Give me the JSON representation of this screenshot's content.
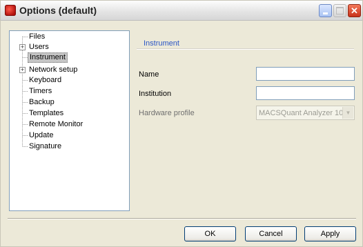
{
  "window": {
    "title": "Options (default)"
  },
  "tree": {
    "items": [
      {
        "label": "Files",
        "expandable": false,
        "selected": false
      },
      {
        "label": "Users",
        "expandable": true,
        "selected": false
      },
      {
        "label": "Instrument",
        "expandable": false,
        "selected": true
      },
      {
        "label": "Network setup",
        "expandable": true,
        "selected": false
      },
      {
        "label": "Keyboard",
        "expandable": false,
        "selected": false
      },
      {
        "label": "Timers",
        "expandable": false,
        "selected": false
      },
      {
        "label": "Backup",
        "expandable": false,
        "selected": false
      },
      {
        "label": "Templates",
        "expandable": false,
        "selected": false
      },
      {
        "label": "Remote Monitor",
        "expandable": false,
        "selected": false
      },
      {
        "label": "Update",
        "expandable": false,
        "selected": false
      },
      {
        "label": "Signature",
        "expandable": false,
        "selected": false
      }
    ]
  },
  "panel": {
    "title": "Instrument",
    "name_label": "Name",
    "name_value": "",
    "institution_label": "Institution",
    "institution_value": "",
    "hardware_label": "Hardware profile",
    "hardware_value": "MACSQuant Analyzer 10"
  },
  "buttons": {
    "ok": "OK",
    "cancel": "Cancel",
    "apply": "Apply"
  },
  "colors": {
    "accent": "#2a55c5",
    "selection": "#c6c6c6",
    "dialog_background": "#ece9d8"
  }
}
